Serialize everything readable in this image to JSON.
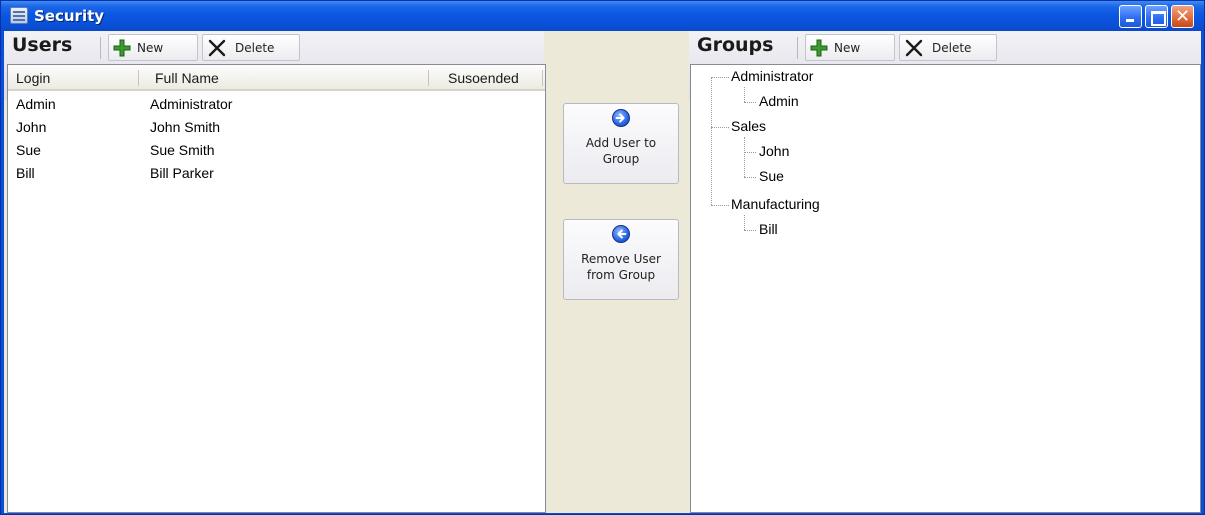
{
  "window": {
    "title": "Security"
  },
  "users_panel": {
    "title": "Users",
    "new_label": "New",
    "delete_label": "Delete",
    "columns": [
      "Login",
      "Full Name",
      "Susoended"
    ],
    "rows": [
      {
        "login": "Admin",
        "full_name": "Administrator",
        "suspended": ""
      },
      {
        "login": "John",
        "full_name": "John Smith",
        "suspended": ""
      },
      {
        "login": "Sue",
        "full_name": "Sue Smith",
        "suspended": ""
      },
      {
        "login": "Bill",
        "full_name": "Bill Parker",
        "suspended": ""
      }
    ]
  },
  "middle": {
    "add_line1": "Add User to",
    "add_line2": "Group",
    "remove_line1": "Remove User",
    "remove_line2": "from Group"
  },
  "groups_panel": {
    "title": "Groups",
    "new_label": "New",
    "delete_label": "Delete",
    "tree": [
      {
        "name": "Administrator",
        "members": [
          "Admin"
        ]
      },
      {
        "name": "Sales",
        "members": [
          "John",
          "Sue"
        ]
      },
      {
        "name": "Manufacturing",
        "members": [
          "Bill"
        ]
      }
    ]
  },
  "icons": {
    "new": "plus-icon",
    "delete": "x-icon",
    "add_user": "arrow-right-icon",
    "remove_user": "arrow-left-icon"
  },
  "colors": {
    "titlebar": "#0a55e0",
    "client_bg": "#ece9d8",
    "new_icon": "#3c9a2e",
    "delete_icon": "#1a1a1a",
    "arrow_icon": "#1f5fe0"
  }
}
